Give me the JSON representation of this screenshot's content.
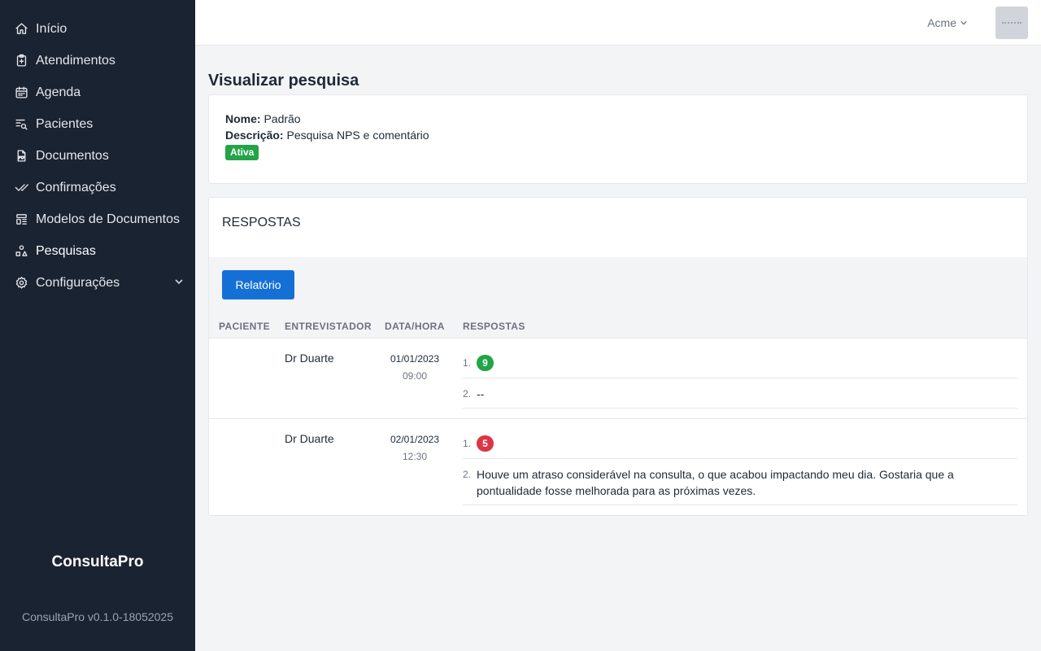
{
  "app": {
    "name": "ConsultaPro",
    "version": "ConsultaPro v0.1.0-18052025"
  },
  "sidebar": {
    "items": [
      {
        "label": "Início",
        "icon": "home-icon"
      },
      {
        "label": "Atendimentos",
        "icon": "clipboard-plus-icon"
      },
      {
        "label": "Agenda",
        "icon": "calendar-icon"
      },
      {
        "label": "Pacientes",
        "icon": "list-search-icon"
      },
      {
        "label": "Documentos",
        "icon": "pdf-file-icon"
      },
      {
        "label": "Confirmações",
        "icon": "double-check-icon"
      },
      {
        "label": "Modelos de Documentos",
        "icon": "layout-icon"
      },
      {
        "label": "Pesquisas",
        "icon": "shapes-icon",
        "active": true
      },
      {
        "label": "Configurações",
        "icon": "gear-icon",
        "expandable": true
      }
    ]
  },
  "topbar": {
    "organization": "Acme"
  },
  "page": {
    "title": "Visualizar pesquisa"
  },
  "survey": {
    "name_label": "Nome:",
    "name": "Padrão",
    "description_label": "Descrição:",
    "description": "Pesquisa NPS e comentário",
    "status": "Ativa"
  },
  "responses": {
    "title": "RESPOSTAS",
    "report_button": "Relatório",
    "columns": [
      "PACIENTE",
      "ENTREVISTADOR",
      "DATA/HORA",
      "RESPOSTAS"
    ],
    "rows": [
      {
        "patient": "",
        "interviewer": "Dr Duarte",
        "date": "01/01/2023",
        "time": "09:00",
        "score_index": "1.",
        "score": "9",
        "score_color": "#22a447",
        "comment_index": "2.",
        "comment": "--"
      },
      {
        "patient": "",
        "interviewer": "Dr Duarte",
        "date": "02/01/2023",
        "time": "12:30",
        "score_index": "1.",
        "score": "5",
        "score_color": "#dc3545",
        "comment_index": "2.",
        "comment": "Houve um atraso considerável na consulta, o que acabou impactando meu dia. Gostaria que a pontualidade fosse melhorada para as próximas vezes."
      }
    ]
  }
}
